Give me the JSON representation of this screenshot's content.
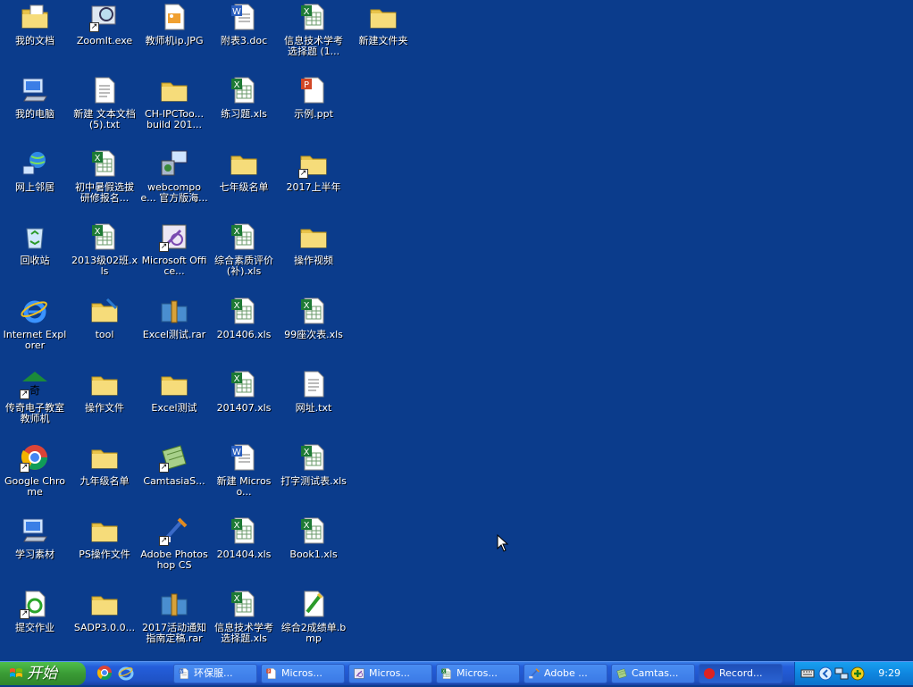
{
  "desktop": {
    "icons": [
      {
        "label": "我的文档",
        "type": "mydocs",
        "shortcut": false
      },
      {
        "label": "我的电脑",
        "type": "computer",
        "shortcut": false
      },
      {
        "label": "网上邻居",
        "type": "network",
        "shortcut": false
      },
      {
        "label": "回收站",
        "type": "recycle",
        "shortcut": false
      },
      {
        "label": "Internet Explorer",
        "type": "ie",
        "shortcut": false
      },
      {
        "label": "传奇电子教室教师机",
        "type": "teacher",
        "shortcut": true
      },
      {
        "label": "Google Chrome",
        "type": "chrome",
        "shortcut": true
      },
      {
        "label": "学习素材",
        "type": "computer",
        "shortcut": false
      },
      {
        "label": "提交作业",
        "type": "submit",
        "shortcut": true
      },
      {
        "label": "ZoomIt.exe",
        "type": "zoomit",
        "shortcut": true
      },
      {
        "label": "新建 文本文档 (5).txt",
        "type": "txt",
        "shortcut": false
      },
      {
        "label": "初中暑假选拔研修报名...",
        "type": "xls",
        "shortcut": false
      },
      {
        "label": "2013级02班.xls",
        "type": "xls",
        "shortcut": false
      },
      {
        "label": "tool",
        "type": "toolfolder",
        "shortcut": false
      },
      {
        "label": "操作文件",
        "type": "folder",
        "shortcut": false
      },
      {
        "label": "九年级名单",
        "type": "folder",
        "shortcut": false
      },
      {
        "label": "PS操作文件",
        "type": "folder",
        "shortcut": false
      },
      {
        "label": "SADP3.0.0...",
        "type": "folder",
        "shortcut": false
      },
      {
        "label": "教师机ip.JPG",
        "type": "jpg",
        "shortcut": false
      },
      {
        "label": "CH-IPCToo... build 201...",
        "type": "folder",
        "shortcut": false
      },
      {
        "label": "webcompoe... 官方版海...",
        "type": "setup",
        "shortcut": false
      },
      {
        "label": "Microsoft Office...",
        "type": "office",
        "shortcut": true
      },
      {
        "label": "Excel测试.rar",
        "type": "rar",
        "shortcut": false
      },
      {
        "label": "Excel测试",
        "type": "folder",
        "shortcut": false
      },
      {
        "label": "CamtasiaS...",
        "type": "camtasia",
        "shortcut": true
      },
      {
        "label": "Adobe Photoshop CS",
        "type": "photoshop",
        "shortcut": true
      },
      {
        "label": "2017活动通知指南定稿.rar",
        "type": "rar",
        "shortcut": false
      },
      {
        "label": "附表3.doc",
        "type": "doc",
        "shortcut": false
      },
      {
        "label": "练习题.xls",
        "type": "xls",
        "shortcut": false
      },
      {
        "label": "七年级名单",
        "type": "folder",
        "shortcut": false
      },
      {
        "label": "综合素质评价(补).xls",
        "type": "xls",
        "shortcut": false
      },
      {
        "label": "201406.xls",
        "type": "xls",
        "shortcut": false
      },
      {
        "label": "201407.xls",
        "type": "xls",
        "shortcut": false
      },
      {
        "label": "新建 Microso...",
        "type": "doc",
        "shortcut": false
      },
      {
        "label": "201404.xls",
        "type": "xls",
        "shortcut": false
      },
      {
        "label": "信息技术学考选择题.xls",
        "type": "xls",
        "shortcut": false
      },
      {
        "label": "信息技术学考选择题 (1...",
        "type": "xls",
        "shortcut": false
      },
      {
        "label": "示例.ppt",
        "type": "ppt",
        "shortcut": false
      },
      {
        "label": "2017上半年",
        "type": "folder",
        "shortcut": true
      },
      {
        "label": "操作视频",
        "type": "folder",
        "shortcut": false
      },
      {
        "label": "99座次表.xls",
        "type": "xls",
        "shortcut": false
      },
      {
        "label": "网址.txt",
        "type": "txt",
        "shortcut": false
      },
      {
        "label": "打字测试表.xls",
        "type": "xls",
        "shortcut": false
      },
      {
        "label": "Book1.xls",
        "type": "xls",
        "shortcut": false
      },
      {
        "label": "综合2成绩单.bmp",
        "type": "bmp",
        "shortcut": false
      },
      {
        "label": "新建文件夹",
        "type": "folder",
        "shortcut": false
      }
    ]
  },
  "taskbar": {
    "start_label": "开始",
    "quick_launch": [
      "chrome-icon",
      "ie-icon"
    ],
    "tasks": [
      {
        "label": "环保服...",
        "icon": "doc",
        "active": false
      },
      {
        "label": "Micros...",
        "icon": "ppt",
        "active": false
      },
      {
        "label": "Micros...",
        "icon": "office",
        "active": false
      },
      {
        "label": "Micros...",
        "icon": "xls",
        "active": false
      },
      {
        "label": "Adobe ...",
        "icon": "photoshop",
        "active": false
      },
      {
        "label": "Camtas...",
        "icon": "camtasia",
        "active": false
      },
      {
        "label": "Record...",
        "icon": "record",
        "active": true
      }
    ],
    "tray_icons": [
      "keyboard-icon",
      "back-arrow-icon",
      "network-icon",
      "add-icon"
    ],
    "clock": "9:29"
  },
  "colors": {
    "desktop_bg": "#0b3c8c",
    "taskbar": "#245edb",
    "start": "#3a9b35",
    "tray": "#0f86df"
  }
}
